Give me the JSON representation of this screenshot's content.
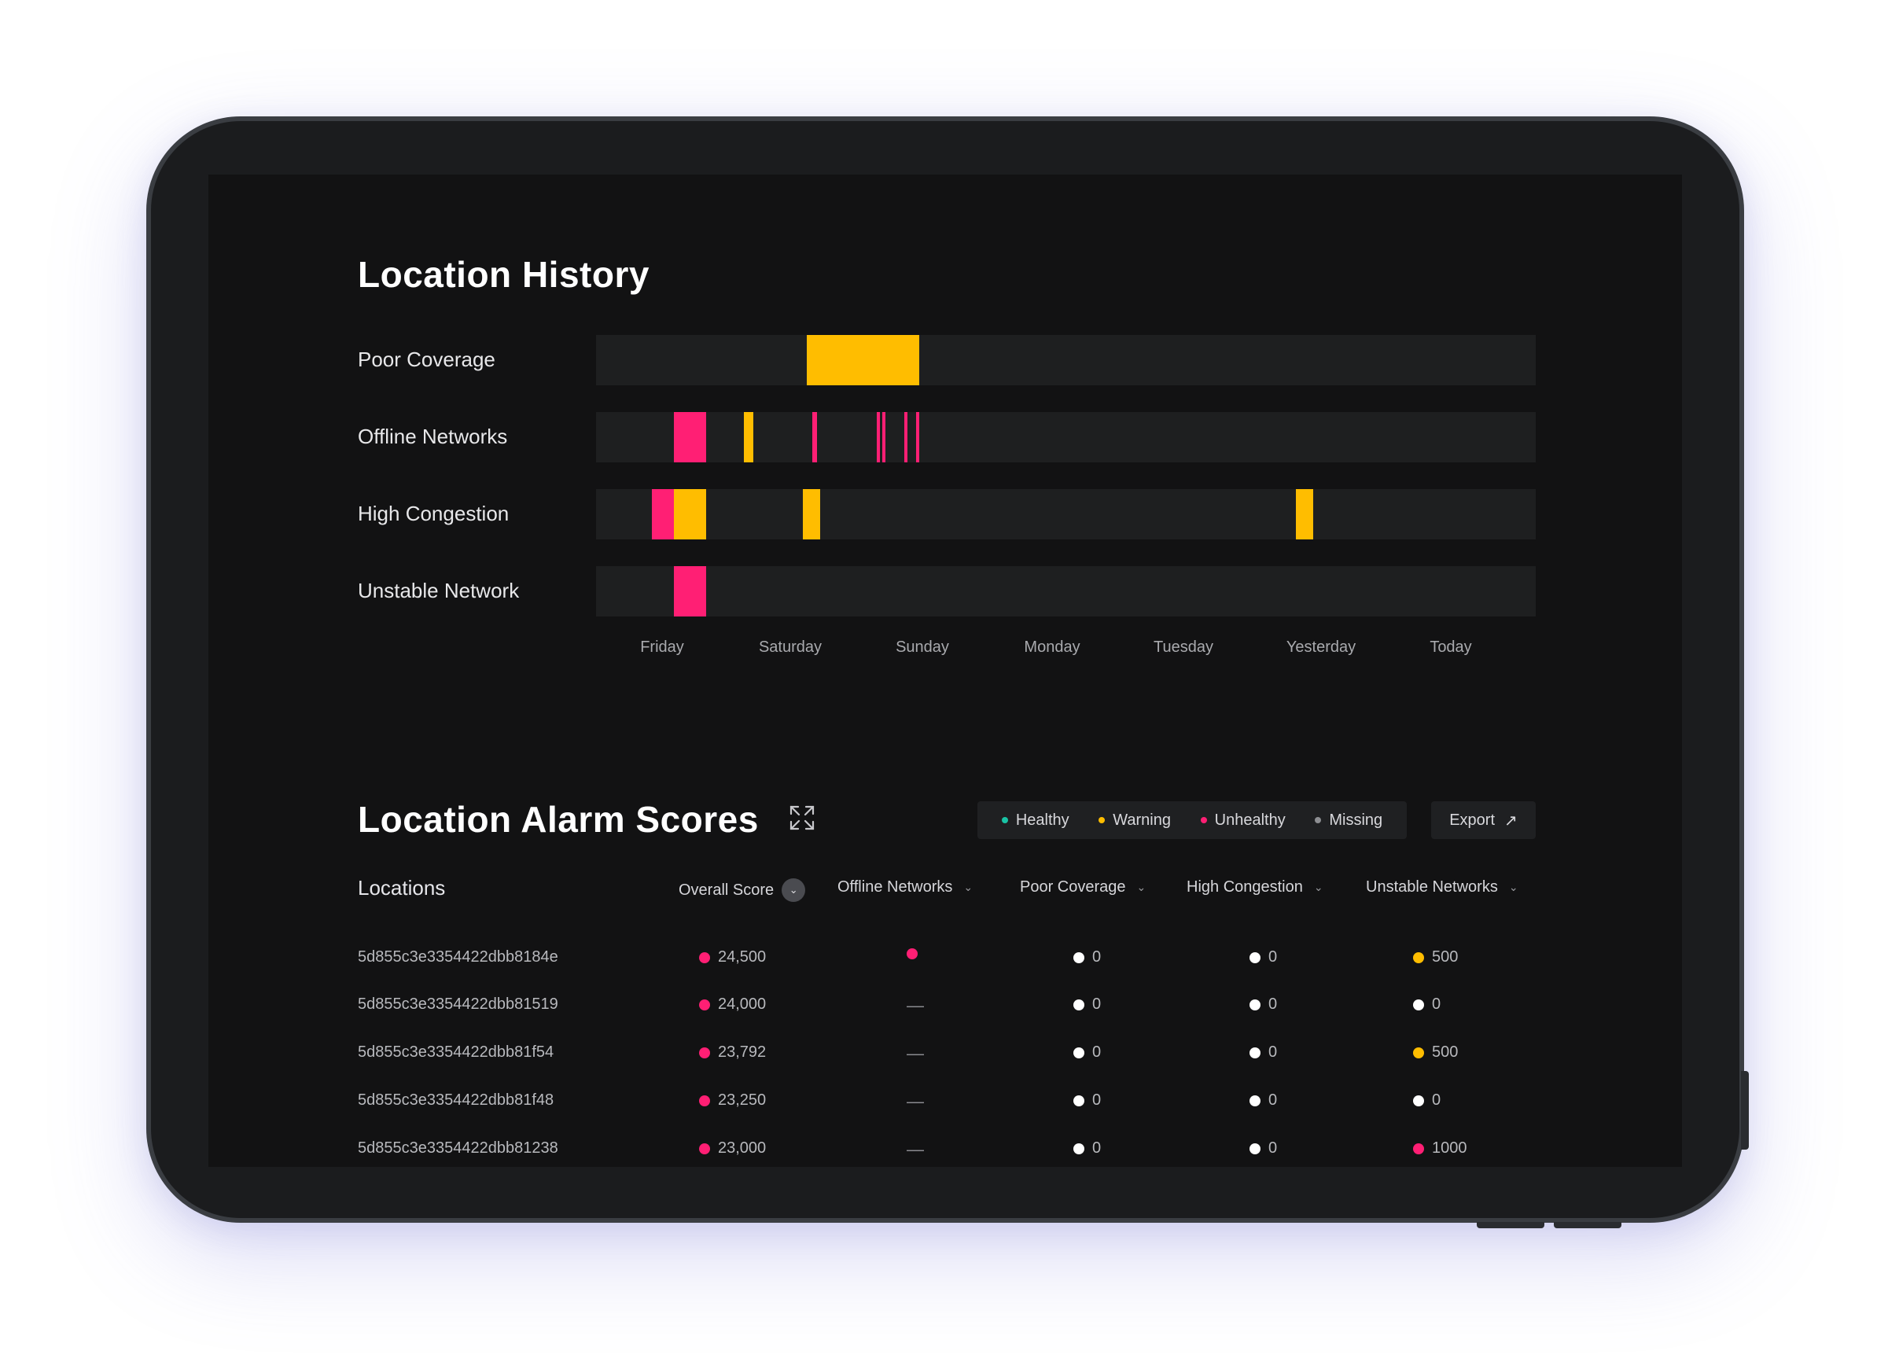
{
  "colors": {
    "healthy": "#19c3a5",
    "warning": "#ffbd00",
    "unhealthy": "#ff1f74",
    "missing": "#8d8e92",
    "neutral": "#ffffff",
    "track": "#1e1f20"
  },
  "history": {
    "title": "Location History",
    "rows": [
      {
        "label": "Poor Coverage",
        "segments": [
          {
            "start": 0.224,
            "end": 0.344,
            "status": "warning"
          }
        ]
      },
      {
        "label": "Offline Networks",
        "segments": [
          {
            "start": 0.083,
            "end": 0.117,
            "status": "unhealthy"
          },
          {
            "start": 0.157,
            "end": 0.167,
            "status": "warning"
          },
          {
            "start": 0.23,
            "end": 0.235,
            "status": "unhealthy"
          },
          {
            "start": 0.299,
            "end": 0.302,
            "status": "unhealthy"
          },
          {
            "start": 0.305,
            "end": 0.308,
            "status": "unhealthy"
          },
          {
            "start": 0.328,
            "end": 0.331,
            "status": "unhealthy"
          },
          {
            "start": 0.341,
            "end": 0.344,
            "status": "unhealthy"
          }
        ]
      },
      {
        "label": "High Congestion",
        "segments": [
          {
            "start": 0.059,
            "end": 0.083,
            "status": "unhealthy"
          },
          {
            "start": 0.083,
            "end": 0.117,
            "status": "warning"
          },
          {
            "start": 0.22,
            "end": 0.238,
            "status": "warning"
          },
          {
            "start": 0.745,
            "end": 0.763,
            "status": "warning"
          }
        ]
      },
      {
        "label": "Unstable Network",
        "segments": [
          {
            "start": 0.083,
            "end": 0.117,
            "status": "unhealthy"
          }
        ]
      }
    ],
    "days": [
      "Friday",
      "Saturday",
      "Sunday",
      "Monday",
      "Tuesday",
      "Yesterday",
      "Today"
    ]
  },
  "alarms": {
    "title": "Location Alarm Scores",
    "legend": [
      {
        "label": "Healthy",
        "status": "healthy"
      },
      {
        "label": "Warning",
        "status": "warning"
      },
      {
        "label": "Unhealthy",
        "status": "unhealthy"
      },
      {
        "label": "Missing",
        "status": "missing"
      }
    ],
    "export_label": "Export",
    "columns": {
      "locations": "Locations",
      "overall": "Overall Score",
      "offline": "Offline Networks",
      "coverage": "Poor Coverage",
      "congestion": "High Congestion",
      "unstable": "Unstable Networks"
    },
    "rows": [
      {
        "id": "5d855c3e3354422dbb8184e",
        "overall": "24,500",
        "offline": "",
        "offline_status": "unhealthy",
        "coverage": "0",
        "congestion": "0",
        "unstable": "500",
        "unstable_status": "warning"
      },
      {
        "id": "5d855c3e3354422dbb81519",
        "overall": "24,000",
        "offline": "—",
        "offline_status": "none",
        "coverage": "0",
        "congestion": "0",
        "unstable": "0",
        "unstable_status": "neutral"
      },
      {
        "id": "5d855c3e3354422dbb81f54",
        "overall": "23,792",
        "offline": "—",
        "offline_status": "none",
        "coverage": "0",
        "congestion": "0",
        "unstable": "500",
        "unstable_status": "warning"
      },
      {
        "id": "5d855c3e3354422dbb81f48",
        "overall": "23,250",
        "offline": "—",
        "offline_status": "none",
        "coverage": "0",
        "congestion": "0",
        "unstable": "0",
        "unstable_status": "neutral"
      },
      {
        "id": "5d855c3e3354422dbb81238",
        "overall": "23,000",
        "offline": "—",
        "offline_status": "none",
        "coverage": "0",
        "congestion": "0",
        "unstable": "1000",
        "unstable_status": "unhealthy"
      }
    ]
  }
}
